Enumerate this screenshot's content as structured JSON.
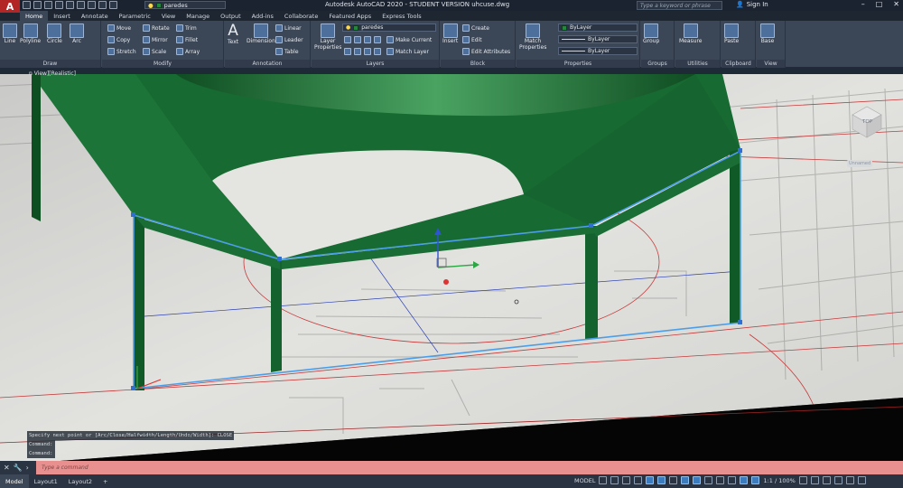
{
  "title_bar": {
    "logo_letter": "A",
    "layer_current": "paredes",
    "title": "Autodesk AutoCAD 2020 - STUDENT VERSION    uhcuse.dwg",
    "search_placeholder": "Type a keyword or phrase",
    "sign_in": "Sign In",
    "win_controls": [
      "–",
      "□",
      "✕"
    ]
  },
  "tabs": [
    "Home",
    "Insert",
    "Annotate",
    "Parametric",
    "View",
    "Manage",
    "Output",
    "Add-ins",
    "Collaborate",
    "Featured Apps",
    "Express Tools"
  ],
  "ribbon": {
    "draw": {
      "title": "Draw",
      "line": "Line",
      "polyline": "Polyline",
      "circle": "Circle",
      "arc": "Arc"
    },
    "modify": {
      "title": "Modify",
      "move": "Move",
      "rotate": "Rotate",
      "trim": "Trim",
      "copy": "Copy",
      "mirror": "Mirror",
      "fillet": "Fillet",
      "stretch": "Stretch",
      "scale": "Scale",
      "array": "Array"
    },
    "annotation": {
      "title": "Annotation",
      "text": "Text",
      "dimension": "Dimension",
      "linear": "Linear",
      "leader": "Leader",
      "table": "Table"
    },
    "layers": {
      "title": "Layers",
      "layer_properties": "Layer Properties",
      "current_layer": "paredes",
      "make_current": "Make Current",
      "match_layer": "Match Layer"
    },
    "block": {
      "title": "Block",
      "insert": "Insert",
      "create": "Create",
      "edit": "Edit",
      "edit_attributes": "Edit Attributes"
    },
    "properties": {
      "title": "Properties",
      "match_properties": "Match Properties",
      "color": "ByLayer",
      "linetype": "ByLayer",
      "lineweight": "ByLayer"
    },
    "groups": {
      "title": "Groups",
      "group": "Group"
    },
    "utilities": {
      "title": "Utilities",
      "measure": "Measure"
    },
    "clipboard": {
      "title": "Clipboard",
      "paste": "Paste"
    },
    "view": {
      "title": "View",
      "base": "Base"
    }
  },
  "viewport": {
    "label": "n View][Realistic]",
    "viewcube_top": "TOP",
    "wcs": "Unnamed"
  },
  "command": {
    "history": [
      "Specify next point or [Arc/Close/Halfwidth/Length/Undo/Width]: CLOSE",
      "Command:",
      "Command:"
    ],
    "prompt": "Type a command"
  },
  "status": {
    "layouts": [
      "Model",
      "Layout1",
      "Layout2"
    ],
    "add_layout": "+",
    "model_label": "MODEL",
    "annotation_scale": "1:1 / 100%"
  },
  "colors": {
    "wall_green": "#1c6e34",
    "accent_blue": "#2f86d6",
    "cmd_bar": "#e88f8f"
  }
}
